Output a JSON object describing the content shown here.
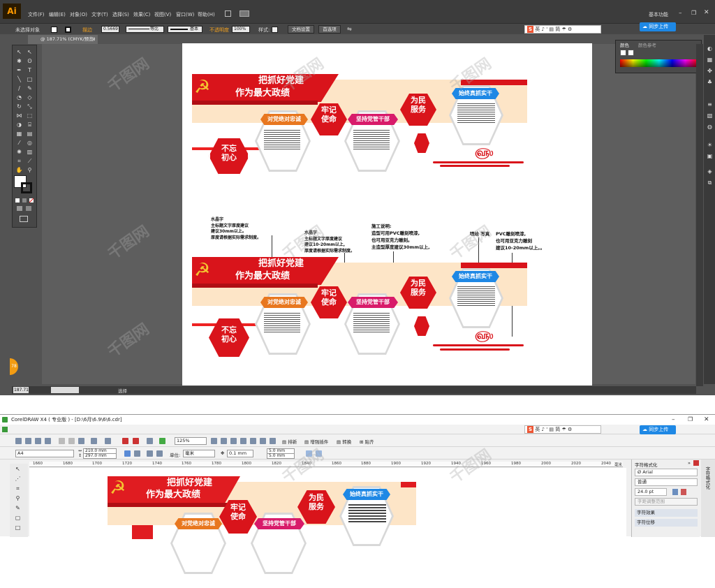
{
  "illustrator": {
    "logo": "Ai",
    "menu": [
      "文件(F)",
      "编辑(E)",
      "对象(O)",
      "文字(T)",
      "选择(S)",
      "效果(C)",
      "视图(V)",
      "窗口(W)",
      "帮助(H)"
    ],
    "workspace": "基本功能",
    "control": {
      "no_selection": "未选择对象",
      "stroke_label": "描边",
      "stroke_value": "0.5669",
      "line1": "等比",
      "line2": "基本",
      "opacity_label": "不透明度",
      "opacity_value": "100%",
      "style_label": "样式:",
      "doc_setup": "文档设置",
      "preferences": "首选项"
    },
    "doc_tab": "@ 187.71% (CMYK/预览)",
    "zoom_status": "187.71",
    "status_label": "选择",
    "color_panel": {
      "tab1": "颜色",
      "tab2": "颜色参考"
    },
    "ime": {
      "brand": "S",
      "items": [
        "英",
        "♪",
        "'",
        "▤",
        "简",
        "☂",
        "⚙"
      ]
    },
    "cloud_btn": "同步上传",
    "badge": "78"
  },
  "design": {
    "slogan_line1": "把抓好党建",
    "slogan_line2": "作为最大政绩",
    "hex_left": "不忘\n初心",
    "pill_1": "对党绝对忠诚",
    "hex_mid": "牢记\n使命",
    "pill_2": "坚持党管干部",
    "hex_right": "为民\n服务",
    "pill_3": "始终真抓实干"
  },
  "notes": {
    "n1": [
      "水晶字",
      "主标题文字厚度建议",
      "建议30mm以上。",
      "厚度请根据实际需求制度。"
    ],
    "n2": [
      "水晶字",
      "主标题文字厚度建议",
      "建议10-20mm以上,",
      "厚度请根据实际需求制度。"
    ],
    "n3": [
      "施工说明:",
      "造型可用PVC雕刻喷漆,",
      "也可用亚克力雕刻。",
      "主造型厚度建议30mm以上,"
    ],
    "n4": [
      "喷绘 写真",
      "PVC雕刻喷漆,",
      "也可用亚克力雕刻",
      "建议10-20mm以上。。"
    ]
  },
  "coreldraw": {
    "title": "CorelDRAW X4 ( 专业版 ) - [D:\\6月\\6.9\\6\\6.cdr]",
    "zoom": "125%",
    "toolbar_items": [
      "排新",
      "增强插件",
      "转换",
      "贴齐"
    ],
    "paper": "A4",
    "width": "210.0 mm",
    "height": "297.0 mm",
    "unit_label": "单位:",
    "unit": "毫米",
    "nudge": "0.1 mm",
    "dup_x": "5.0 mm",
    "dup_y": "5.0 mm",
    "ruler": [
      "1660",
      "1680",
      "1700",
      "1720",
      "1740",
      "1760",
      "1780",
      "1800",
      "1820",
      "1840",
      "1860",
      "1880",
      "1900",
      "1920",
      "1940",
      "1960",
      "1980",
      "2000",
      "2020",
      "2040",
      "毫米"
    ],
    "docker": {
      "title": "字符格式化",
      "font": "Arial",
      "style": "普通",
      "size": "24.0 pt",
      "kerning": "字距调整范围",
      "sec1": "字符效果",
      "sec2": "字符位移"
    },
    "side_tab": "字符格式化",
    "cloud_btn": "同步上传"
  },
  "watermark": "千图网",
  "colors": {
    "red": "#d9141b",
    "cream": "#fde5c7",
    "pink": "#d81b6a",
    "blue": "#1e88e5"
  }
}
